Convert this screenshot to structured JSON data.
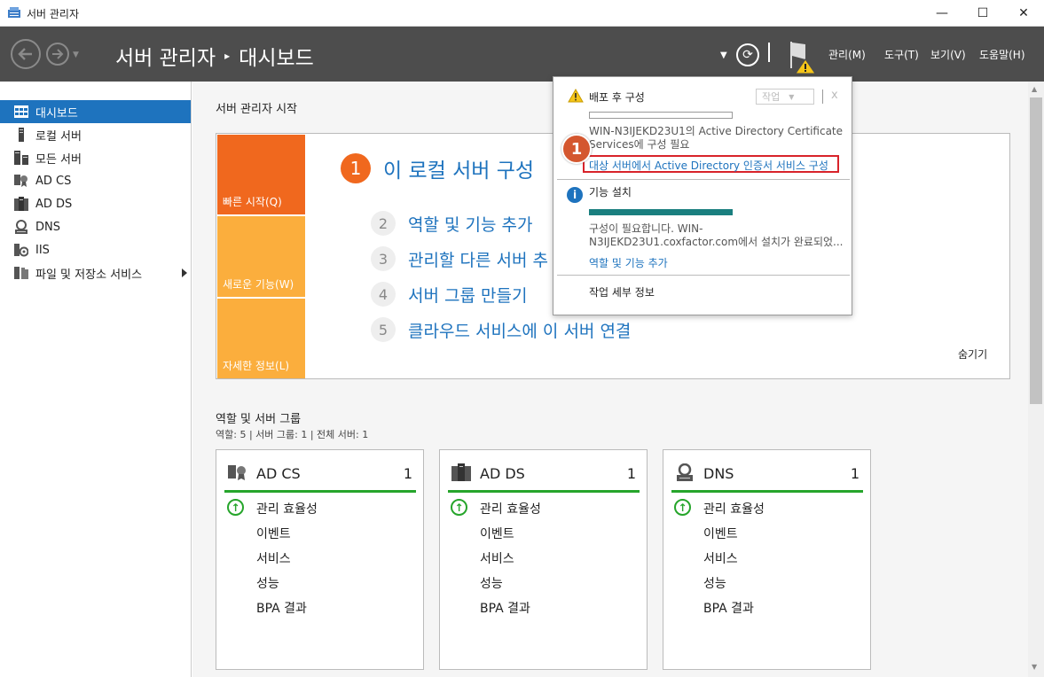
{
  "window": {
    "title": "서버 관리자",
    "controls": {
      "minimize": "—",
      "maximize": "☐",
      "close": "✕"
    }
  },
  "header": {
    "breadcrumb_root": "서버 관리자",
    "breadcrumb_sep": "▸",
    "breadcrumb_current": "대시보드",
    "menus": [
      "관리(M)",
      "도구(T)",
      "보기(V)",
      "도움말(H)"
    ]
  },
  "sidebar": {
    "items": [
      {
        "label": "대시보드",
        "icon": "dashboard-icon"
      },
      {
        "label": "로컬 서버",
        "icon": "server-icon"
      },
      {
        "label": "모든 서버",
        "icon": "servers-icon"
      },
      {
        "label": "AD CS",
        "icon": "certificate-icon"
      },
      {
        "label": "AD DS",
        "icon": "directory-icon"
      },
      {
        "label": "DNS",
        "icon": "dns-icon"
      },
      {
        "label": "IIS",
        "icon": "iis-icon"
      },
      {
        "label": "파일 및 저장소 서비스",
        "icon": "file-storage-icon"
      }
    ]
  },
  "welcome": {
    "title": "서버 관리자 시작",
    "tiles": [
      "빠른 시작(Q)",
      "새로운 기능(W)",
      "자세한 정보(L)"
    ],
    "step1_num": "1",
    "step1_text": "이 로컬 서버 구성",
    "steps": [
      {
        "num": "2",
        "text": "역할 및 기능 추가"
      },
      {
        "num": "3",
        "text": "관리할 다른 서버 추"
      },
      {
        "num": "4",
        "text": "서버 그룹 만들기"
      },
      {
        "num": "5",
        "text": "클라우드 서비스에 이 서버 연결"
      }
    ],
    "hide_label": "숨기기"
  },
  "roles": {
    "title": "역할 및 서버 그룹",
    "summary": "역할: 5  |  서버 그룹: 1  |  전체 서버: 1",
    "cards": [
      {
        "name": "AD CS",
        "count": "1",
        "rows": [
          "관리 효율성",
          "이벤트",
          "서비스",
          "성능",
          "BPA 결과"
        ]
      },
      {
        "name": "AD DS",
        "count": "1",
        "rows": [
          "관리 효율성",
          "이벤트",
          "서비스",
          "성능",
          "BPA 결과"
        ]
      },
      {
        "name": "DNS",
        "count": "1",
        "rows": [
          "관리 효율성",
          "이벤트",
          "서비스",
          "성능",
          "BPA 결과"
        ]
      }
    ]
  },
  "notifications": {
    "post_deploy_title": "배포 후 구성",
    "task_dropdown": "작업",
    "close": "x",
    "post_deploy_msg_line1": "WIN-N3IJEKD23U1의 Active Directory Certificate",
    "post_deploy_msg_line2": "Services에 구성 필요",
    "post_deploy_link": "대상 서버에서 Active Directory 인증서 서비스 구성",
    "badge": "1",
    "feature_title": "기능 설치",
    "feature_msg_line1": "구성이 필요합니다. WIN-",
    "feature_msg_line2": "N3IJEKD23U1.coxfactor.com에서 설치가 완료되었...",
    "feature_link": "역할 및 기능 추가",
    "task_details": "작업 세부 정보"
  },
  "colors": {
    "header_bg": "#4d4d4d",
    "accent_blue": "#1e73be",
    "tile_orange": "#f0681e",
    "tile_amber": "#fbae3d",
    "status_green": "#26a52b",
    "highlight_red": "#d8232a"
  }
}
